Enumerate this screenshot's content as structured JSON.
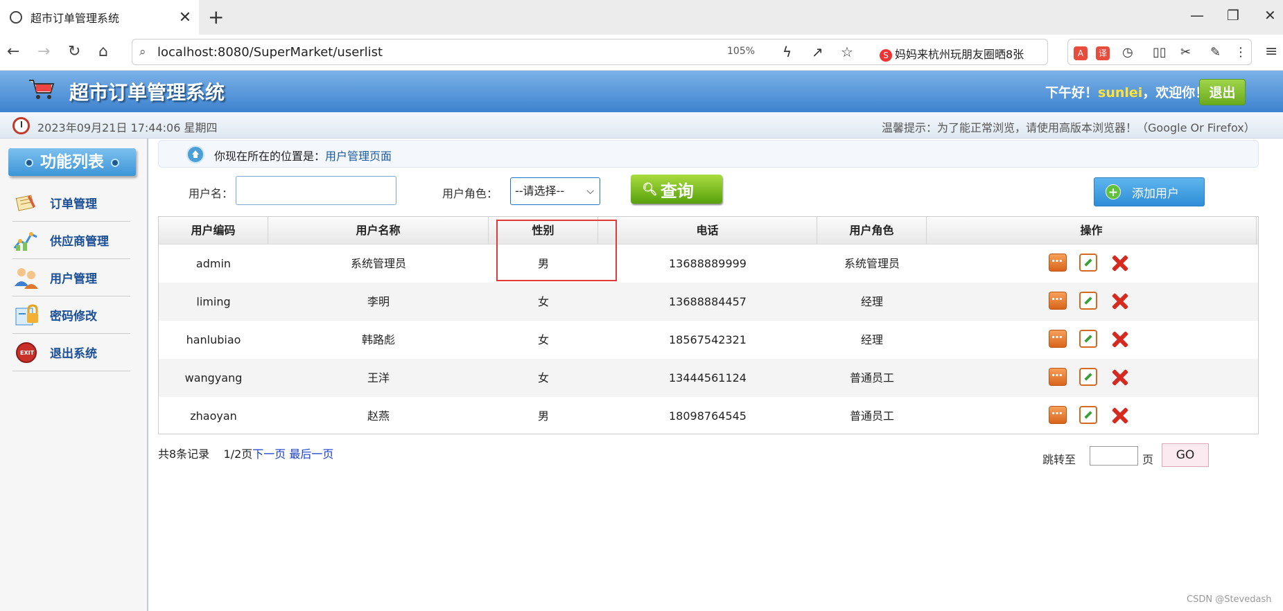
{
  "browser": {
    "tab_title": "超市订单管理系统",
    "url": "localhost:8080/SuperMarket/userlist",
    "zoom": "105%",
    "search_suggestion": "妈妈来杭州玩朋友圈晒8张"
  },
  "header": {
    "title": "超市订单管理系统",
    "greeting_prefix": "下午好！",
    "username": "sunlei",
    "greeting_suffix": "，欢迎你！",
    "logout": "退出"
  },
  "infobar": {
    "datetime": "2023年09月21日 17:44:06 星期四",
    "tip": "温馨提示：为了能正常浏览，请使用高版本浏览器！（Google Or Firefox）"
  },
  "sidebar": {
    "title": "功能列表",
    "items": [
      {
        "label": "订单管理",
        "icon": "order-icon"
      },
      {
        "label": "供应商管理",
        "icon": "supplier-icon"
      },
      {
        "label": "用户管理",
        "icon": "users-icon"
      },
      {
        "label": "密码修改",
        "icon": "password-icon"
      },
      {
        "label": "退出系统",
        "icon": "exit-icon"
      }
    ]
  },
  "breadcrumb": {
    "prefix": "你现在所在的位置是：",
    "current": "用户管理页面"
  },
  "search": {
    "username_label": "用户名：",
    "username_value": "",
    "role_label": "用户角色：",
    "role_selected": "--请选择--",
    "query_button": "查询",
    "add_button": "添加用户"
  },
  "table": {
    "headers": [
      "用户编码",
      "用户名称",
      "性别",
      "电话",
      "用户角色",
      "操作"
    ],
    "rows": [
      [
        "admin",
        "系统管理员",
        "男",
        "13688889999",
        "系统管理员"
      ],
      [
        "liming",
        "李明",
        "女",
        "13688884457",
        "经理"
      ],
      [
        "hanlubiao",
        "韩路彪",
        "女",
        "18567542321",
        "经理"
      ],
      [
        "wangyang",
        "王洋",
        "女",
        "13444561124",
        "普通员工"
      ],
      [
        "zhaoyan",
        "赵燕",
        "男",
        "18098764545",
        "普通员工"
      ]
    ]
  },
  "pager": {
    "total": "共8条记录",
    "page": "1/2页",
    "next": "下一页",
    "last": "最后一页",
    "jump_label": "跳转至",
    "page_unit": "页",
    "go": "GO"
  },
  "watermark": "CSDN @Stevedash",
  "colors": {
    "header_blue": "#3d83cf",
    "accent_green": "#6aaa1f",
    "highlight_red": "#e23a3a",
    "link_blue": "#1a5a9e"
  }
}
